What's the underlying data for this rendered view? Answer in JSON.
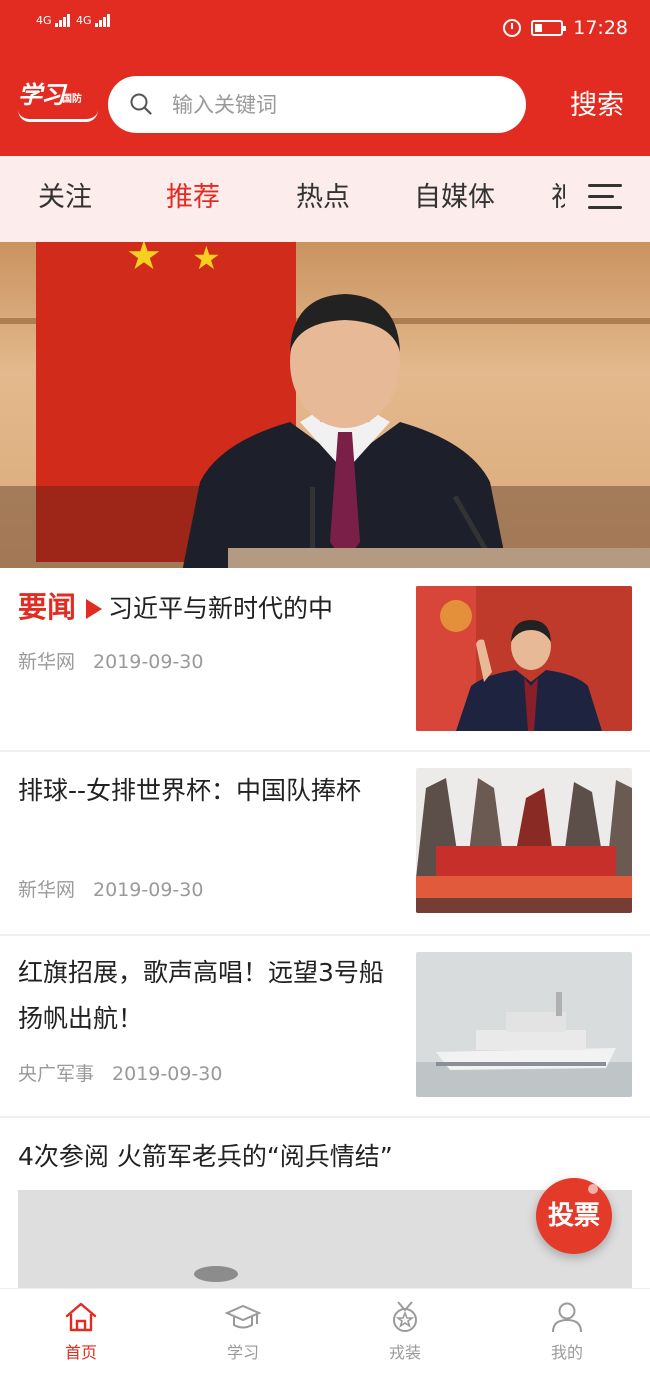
{
  "status_bar": {
    "signal_1": "4G",
    "signal_2": "4G",
    "time": "17:28"
  },
  "header": {
    "logo_text": "学习",
    "logo_sub": "国防",
    "search_placeholder": "输入关键词",
    "search_button": "搜索"
  },
  "tabs": [
    {
      "label": "关注",
      "active": false
    },
    {
      "label": "推荐",
      "active": true
    },
    {
      "label": "热点",
      "active": false
    },
    {
      "label": "自媒体",
      "active": false
    },
    {
      "label": "视",
      "active": false
    }
  ],
  "news": [
    {
      "tag": "要闻",
      "title": "习近平与新时代的中",
      "source": "新华网",
      "date": "2019-09-30"
    },
    {
      "title": "排球--女排世界杯：中国队捧杯",
      "source": "新华网",
      "date": "2019-09-30"
    },
    {
      "title": "红旗招展，歌声高唱！远望3号船扬帆出航！",
      "source": "央广军事",
      "date": "2019-09-30"
    },
    {
      "title": "4次参阅 火箭军老兵的“阅兵情结”"
    }
  ],
  "vote_button": "投票",
  "bottom_nav": [
    {
      "label": "首页",
      "icon": "home-icon",
      "active": true
    },
    {
      "label": "学习",
      "icon": "graduation-cap-icon",
      "active": false
    },
    {
      "label": "戎装",
      "icon": "medal-icon",
      "active": false
    },
    {
      "label": "我的",
      "icon": "user-icon",
      "active": false
    }
  ],
  "colors": {
    "brand_red": "#e22c22",
    "tab_bg": "#fcecec",
    "meta_gray": "#9a9a9a"
  }
}
